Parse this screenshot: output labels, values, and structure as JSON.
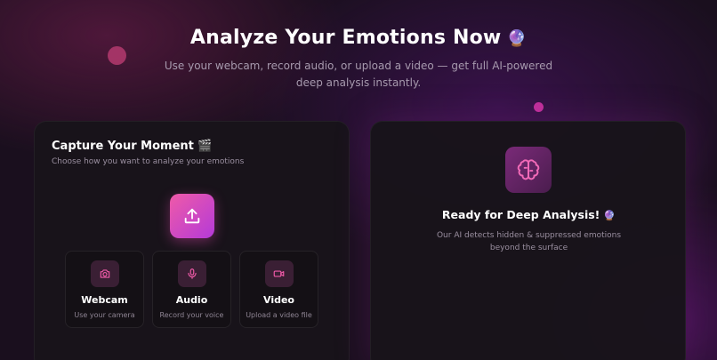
{
  "header": {
    "title": "Analyze Your Emotions Now",
    "title_emoji": "🔮",
    "subtitle": "Use your webcam, record audio, or upload a video — get full AI-powered deep analysis instantly."
  },
  "capture": {
    "title": "Capture Your Moment",
    "title_emoji": "🎬",
    "subtitle": "Choose how you want to analyze your emotions",
    "upload_icon": "upload-icon",
    "options": [
      {
        "label": "Webcam",
        "sub": "Use your camera",
        "icon": "camera-icon"
      },
      {
        "label": "Audio",
        "sub": "Record your voice",
        "icon": "microphone-icon"
      },
      {
        "label": "Video",
        "sub": "Upload a video file",
        "icon": "video-icon"
      }
    ]
  },
  "analysis": {
    "icon": "brain-icon",
    "title": "Ready for Deep Analysis!",
    "title_emoji": "🔮",
    "subtitle": "Our AI detects hidden & suppressed emotions beyond the surface"
  },
  "colors": {
    "accent_pink": "#ef5aa8",
    "accent_purple": "#b43ad8",
    "background": "#1a0f1e",
    "card": "#18141a"
  }
}
